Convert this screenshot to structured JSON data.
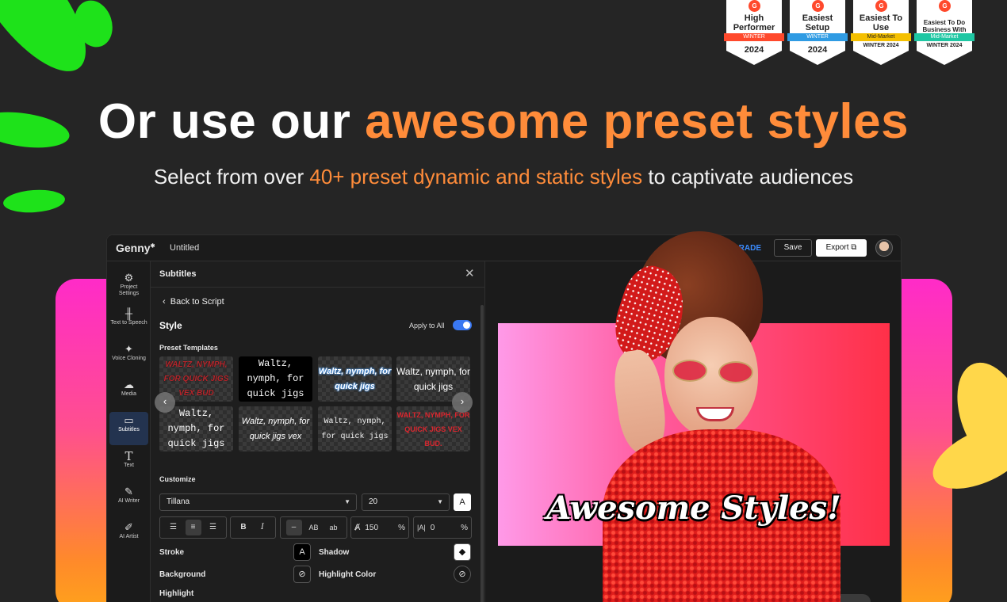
{
  "badges": [
    {
      "title": "High Performer",
      "ribbon": "WINTER",
      "year": "2024",
      "ribbon_color": "#ff492c"
    },
    {
      "title": "Easiest Setup",
      "ribbon": "WINTER",
      "year": "2024",
      "ribbon_color": "#2f9be3"
    },
    {
      "title": "Easiest To Use",
      "ribbon": "Mid-Market",
      "year": "WINTER 2024",
      "ribbon_color": "#f5c000"
    },
    {
      "title": "Easiest To Do Business With",
      "ribbon": "Mid-Market",
      "year": "WINTER 2024",
      "ribbon_color": "#1fc7a3"
    }
  ],
  "hero": {
    "title_plain": "Or use our",
    "title_accent": "awesome preset styles",
    "sub_pre": "Select from over",
    "sub_accent": "40+ preset dynamic and static styles",
    "sub_post": "to captivate audiences"
  },
  "topbar": {
    "logo": "Genny",
    "doc_title": "Untitled",
    "upgrade": "UPGRADE",
    "save": "Save",
    "export": "Export"
  },
  "rail": [
    {
      "label": "Project Settings",
      "icon": "gear-icon"
    },
    {
      "label": "Text to Speech",
      "icon": "waveform-icon"
    },
    {
      "label": "Voice Cloning",
      "icon": "sparkle-icon"
    },
    {
      "label": "Media",
      "icon": "cloud-upload-icon"
    },
    {
      "label": "Subtitles",
      "icon": "subtitles-icon"
    },
    {
      "label": "Text",
      "icon": "text-icon"
    },
    {
      "label": "AI Writer",
      "icon": "quill-icon"
    },
    {
      "label": "AI Artist",
      "icon": "brush-icon"
    }
  ],
  "panel": {
    "title": "Subtitles",
    "back": "Back to Script",
    "style_label": "Style",
    "apply_all": "Apply to All",
    "apply_all_on": true,
    "preset_label": "Preset Templates",
    "presets": [
      "WALTZ, NYMPH, FOR QUICK JIGS VEX BUD",
      "Waltz, nymph, for quick jigs",
      "Waltz, nymph, for quick jigs",
      "Waltz, nymph, for quick jigs",
      "Waltz, nymph, for quick jigs",
      "Waltz, nymph, for quick jigs vex",
      "Waltz, nymph, for quick jigs",
      "WALTZ, NYMPH, FOR QUICK JIGS VEX BUD."
    ],
    "customize_label": "Customize",
    "font": "Tillana",
    "font_size": "20",
    "color_btn": "A",
    "bold": "B",
    "italic": "I",
    "case_none": "–",
    "case_upper": "AB",
    "case_lower": "ab",
    "line_height": "150",
    "line_height_unit": "%",
    "letter_spacing": "0",
    "letter_spacing_unit": "%",
    "stroke_label": "Stroke",
    "shadow_label": "Shadow",
    "background_label": "Background",
    "highlight_color_label": "Highlight Color",
    "highlight_label": "Highlight"
  },
  "preview": {
    "caption": "Awesome Styles!"
  }
}
